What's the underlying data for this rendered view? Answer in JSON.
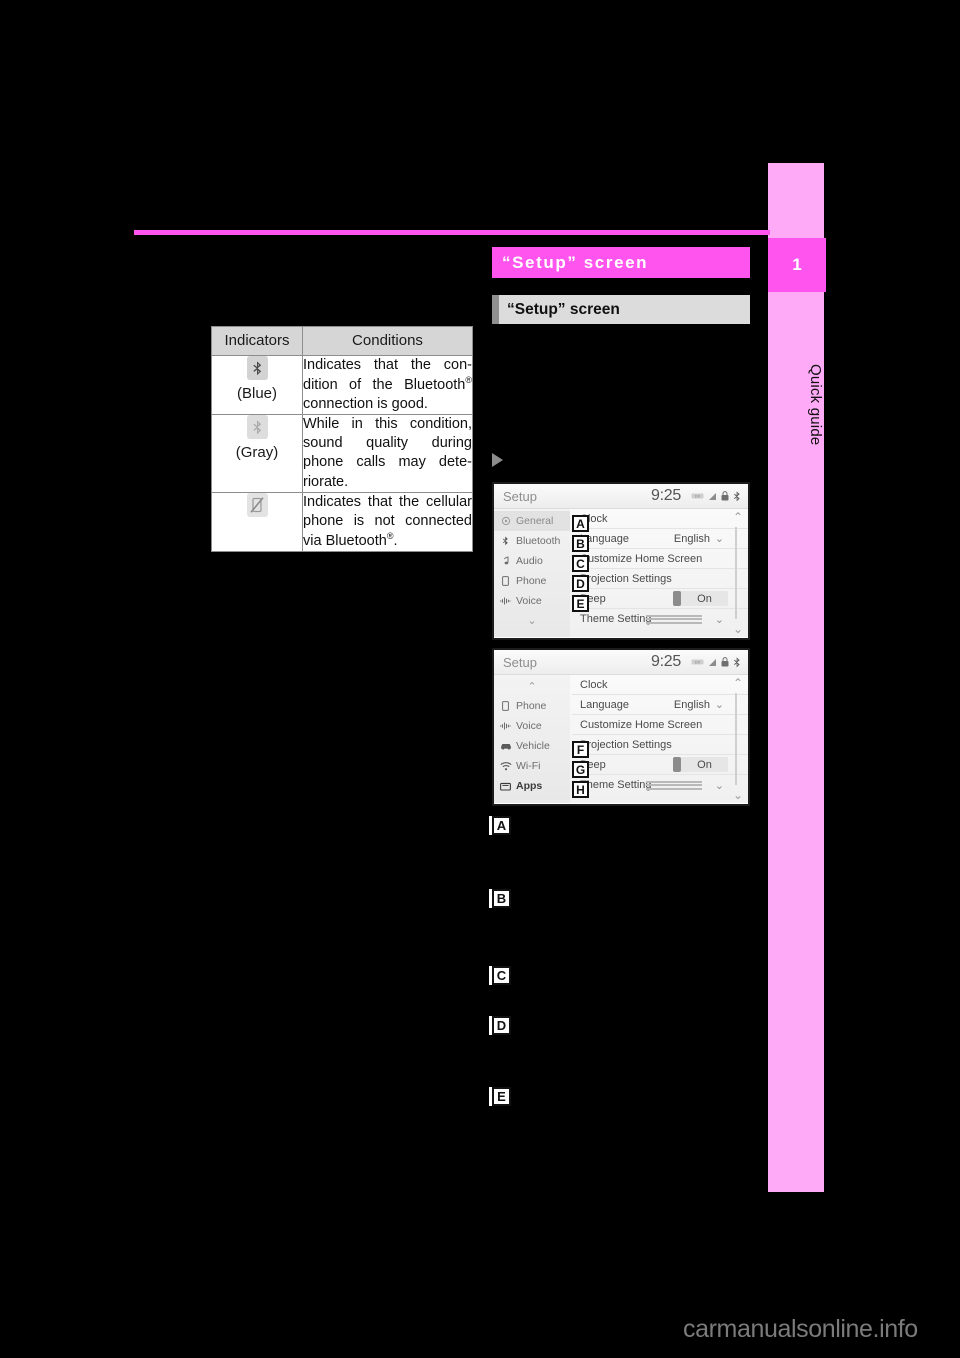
{
  "page": {
    "chapter_number": "1",
    "chapter_label": "Quick guide",
    "watermark": "carmanualsonline.info",
    "accent_color": "#ff55ee",
    "tab_color": "#ffaaf7"
  },
  "indicator_table": {
    "headers": [
      "Indicators",
      "Conditions"
    ],
    "rows": [
      {
        "icon": "bluetooth-icon",
        "icon_color": "blue",
        "icon_label": "(Blue)",
        "condition_parts": [
          "Indicates that the condition of the Blue-tooth",
          "®",
          " connection is good."
        ],
        "condition": "Indicates that the condition of the Bluetooth® connection is good."
      },
      {
        "icon": "bluetooth-icon",
        "icon_color": "gray",
        "icon_label": "(Gray)",
        "condition_parts": [
          "While in this condition, sound quality during phone calls may deteriorate.",
          "",
          ""
        ],
        "condition": "While in this condition, sound quality during phone calls may deteriorate."
      },
      {
        "icon": "phone-disconnected-icon",
        "icon_color": "gray",
        "icon_label": "",
        "condition_parts": [
          "Indicates that the cellular phone is not connected via Bluetooth",
          "®",
          "."
        ],
        "condition": "Indicates that the cellular phone is not connected via Bluetooth®."
      }
    ]
  },
  "section": {
    "title": "“Setup” screen",
    "subtitle": "“Setup” screen"
  },
  "screens": [
    {
      "id": "screen-1",
      "status_bar": {
        "title": "Setup",
        "clock": "9:25",
        "icons": [
          "badge-icon",
          "signal-icon",
          "lock-icon",
          "bluetooth-icon"
        ]
      },
      "nav_items": [
        {
          "label": "General",
          "icon": "gear-icon",
          "selected": true
        },
        {
          "label": "Bluetooth",
          "icon": "bluetooth-icon",
          "selected": false
        },
        {
          "label": "Audio",
          "icon": "music-note-icon",
          "selected": false
        },
        {
          "label": "Phone",
          "icon": "phone-icon",
          "selected": false
        },
        {
          "label": "Voice",
          "icon": "voice-icon",
          "selected": false
        }
      ],
      "nav_scroll_down": "chevron-down-icon",
      "list_items": [
        {
          "label": "Clock",
          "value": "",
          "control": "none",
          "badge": "A"
        },
        {
          "label": "Language",
          "value": "English",
          "control": "chevron",
          "badge": "B"
        },
        {
          "label": "Customize Home Screen",
          "value": "",
          "control": "none",
          "badge": "C"
        },
        {
          "label": "Projection Settings",
          "value": "",
          "control": "none",
          "badge": "D"
        },
        {
          "label": "Beep",
          "value": "On",
          "control": "toggle",
          "badge": "E"
        },
        {
          "label": "Theme Setting",
          "value": "",
          "control": "slider",
          "badge": ""
        }
      ]
    },
    {
      "id": "screen-2",
      "status_bar": {
        "title": "Setup",
        "clock": "9:25",
        "icons": [
          "badge-icon",
          "signal-icon",
          "lock-icon",
          "bluetooth-icon"
        ]
      },
      "nav_scroll_up": "chevron-up-icon",
      "nav_items": [
        {
          "label": "Phone",
          "icon": "phone-icon",
          "selected": false
        },
        {
          "label": "Voice",
          "icon": "voice-icon",
          "selected": false
        },
        {
          "label": "Vehicle",
          "icon": "car-icon",
          "selected": false
        },
        {
          "label": "Wi-Fi",
          "icon": "wifi-icon",
          "selected": false
        },
        {
          "label": "Apps",
          "icon": "apps-icon",
          "selected": false,
          "bold": true
        }
      ],
      "list_items": [
        {
          "label": "Clock",
          "value": "",
          "control": "none",
          "badge": ""
        },
        {
          "label": "Language",
          "value": "English",
          "control": "chevron",
          "badge": ""
        },
        {
          "label": "Customize Home Screen",
          "value": "",
          "control": "none",
          "badge": ""
        },
        {
          "label": "Projection Settings",
          "value": "",
          "control": "none",
          "badge": "F"
        },
        {
          "label": "Beep",
          "value": "On",
          "control": "toggle",
          "badge": "G"
        },
        {
          "label": "Theme Setting",
          "value": "",
          "control": "slider",
          "badge": "H"
        }
      ]
    }
  ],
  "callouts": [
    {
      "letter": "A",
      "text": ""
    },
    {
      "letter": "B",
      "text": ""
    },
    {
      "letter": "C",
      "text": ""
    },
    {
      "letter": "D",
      "text": ""
    },
    {
      "letter": "E",
      "text": ""
    }
  ]
}
